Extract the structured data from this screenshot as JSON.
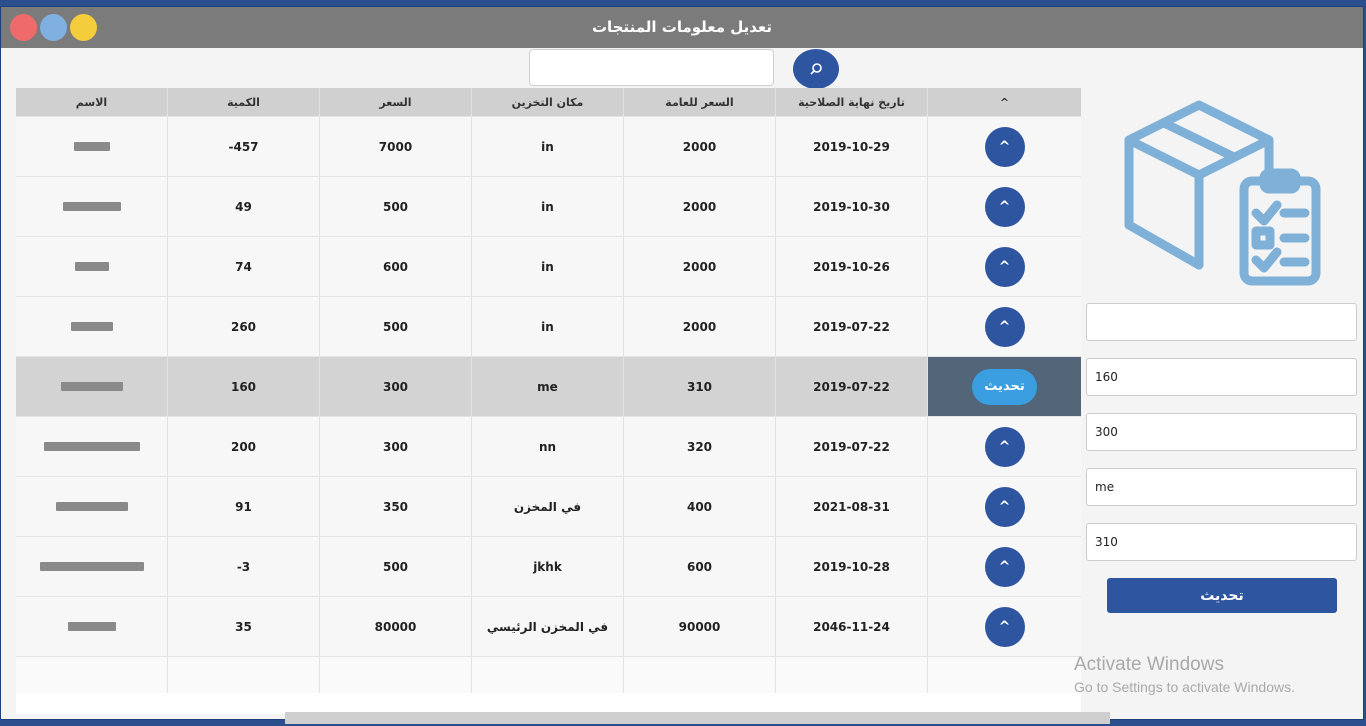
{
  "window": {
    "title": "تعديل معلومات المنتجات",
    "colors": {
      "titlebar": "#7b7b7b",
      "accent": "#2d55a0",
      "selected_button": "#3a9ee0"
    }
  },
  "search": {
    "placeholder": "",
    "value": "",
    "icon": "search-icon"
  },
  "table": {
    "columns": [
      "الاسم",
      "الكمية",
      "السعر",
      "مكان التخزين",
      "السعر للعامة",
      "تاريخ نهاية الصلاحية",
      "^"
    ],
    "rows": [
      {
        "qty": "-457",
        "price": "7000",
        "location": "in",
        "public_price": "2000",
        "expiry": "2019-10-29",
        "action": "^"
      },
      {
        "qty": "49",
        "price": "500",
        "location": "in",
        "public_price": "2000",
        "expiry": "2019-10-30",
        "action": "^"
      },
      {
        "qty": "74",
        "price": "600",
        "location": "in",
        "public_price": "2000",
        "expiry": "2019-10-26",
        "action": "^"
      },
      {
        "qty": "260",
        "price": "500",
        "location": "in",
        "public_price": "2000",
        "expiry": "2019-07-22",
        "action": "^"
      },
      {
        "qty": "160",
        "price": "300",
        "location": "me",
        "public_price": "310",
        "expiry": "2019-07-22",
        "action": "تحديث"
      },
      {
        "qty": "200",
        "price": "300",
        "location": "nn",
        "public_price": "320",
        "expiry": "2019-07-22",
        "action": "^"
      },
      {
        "qty": "91",
        "price": "350",
        "location": "في المخزن",
        "public_price": "400",
        "expiry": "2021-08-31",
        "action": "^"
      },
      {
        "qty": "-3",
        "price": "500",
        "location": "jkhk",
        "public_price": "600",
        "expiry": "2019-10-28",
        "action": "^"
      },
      {
        "qty": "35",
        "price": "80000",
        "location": "في المخزن الرئيسي",
        "public_price": "90000",
        "expiry": "2046-11-24",
        "action": "^"
      }
    ]
  },
  "form": {
    "name_value": "",
    "qty_value": "160",
    "price_value": "300",
    "location_value": "me",
    "public_price_value": "310",
    "submit_label": "تحديث",
    "illustration": "box-clipboard-icon"
  },
  "watermark": {
    "line1": "Activate Windows",
    "line2": "Go to Settings to activate Windows."
  }
}
